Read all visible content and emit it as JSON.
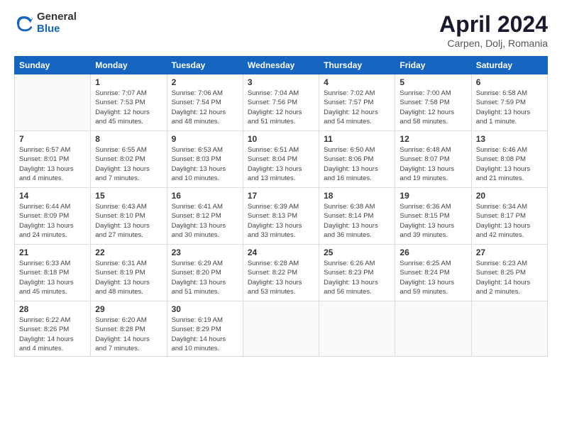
{
  "header": {
    "logo": {
      "general": "General",
      "blue": "Blue"
    },
    "title": "April 2024",
    "location": "Carpen, Dolj, Romania"
  },
  "calendar": {
    "days_of_week": [
      "Sunday",
      "Monday",
      "Tuesday",
      "Wednesday",
      "Thursday",
      "Friday",
      "Saturday"
    ],
    "weeks": [
      [
        {
          "day": "",
          "info": ""
        },
        {
          "day": "1",
          "info": "Sunrise: 7:07 AM\nSunset: 7:53 PM\nDaylight: 12 hours\nand 45 minutes."
        },
        {
          "day": "2",
          "info": "Sunrise: 7:06 AM\nSunset: 7:54 PM\nDaylight: 12 hours\nand 48 minutes."
        },
        {
          "day": "3",
          "info": "Sunrise: 7:04 AM\nSunset: 7:56 PM\nDaylight: 12 hours\nand 51 minutes."
        },
        {
          "day": "4",
          "info": "Sunrise: 7:02 AM\nSunset: 7:57 PM\nDaylight: 12 hours\nand 54 minutes."
        },
        {
          "day": "5",
          "info": "Sunrise: 7:00 AM\nSunset: 7:58 PM\nDaylight: 12 hours\nand 58 minutes."
        },
        {
          "day": "6",
          "info": "Sunrise: 6:58 AM\nSunset: 7:59 PM\nDaylight: 13 hours\nand 1 minute."
        }
      ],
      [
        {
          "day": "7",
          "info": "Sunrise: 6:57 AM\nSunset: 8:01 PM\nDaylight: 13 hours\nand 4 minutes."
        },
        {
          "day": "8",
          "info": "Sunrise: 6:55 AM\nSunset: 8:02 PM\nDaylight: 13 hours\nand 7 minutes."
        },
        {
          "day": "9",
          "info": "Sunrise: 6:53 AM\nSunset: 8:03 PM\nDaylight: 13 hours\nand 10 minutes."
        },
        {
          "day": "10",
          "info": "Sunrise: 6:51 AM\nSunset: 8:04 PM\nDaylight: 13 hours\nand 13 minutes."
        },
        {
          "day": "11",
          "info": "Sunrise: 6:50 AM\nSunset: 8:06 PM\nDaylight: 13 hours\nand 16 minutes."
        },
        {
          "day": "12",
          "info": "Sunrise: 6:48 AM\nSunset: 8:07 PM\nDaylight: 13 hours\nand 19 minutes."
        },
        {
          "day": "13",
          "info": "Sunrise: 6:46 AM\nSunset: 8:08 PM\nDaylight: 13 hours\nand 21 minutes."
        }
      ],
      [
        {
          "day": "14",
          "info": "Sunrise: 6:44 AM\nSunset: 8:09 PM\nDaylight: 13 hours\nand 24 minutes."
        },
        {
          "day": "15",
          "info": "Sunrise: 6:43 AM\nSunset: 8:10 PM\nDaylight: 13 hours\nand 27 minutes."
        },
        {
          "day": "16",
          "info": "Sunrise: 6:41 AM\nSunset: 8:12 PM\nDaylight: 13 hours\nand 30 minutes."
        },
        {
          "day": "17",
          "info": "Sunrise: 6:39 AM\nSunset: 8:13 PM\nDaylight: 13 hours\nand 33 minutes."
        },
        {
          "day": "18",
          "info": "Sunrise: 6:38 AM\nSunset: 8:14 PM\nDaylight: 13 hours\nand 36 minutes."
        },
        {
          "day": "19",
          "info": "Sunrise: 6:36 AM\nSunset: 8:15 PM\nDaylight: 13 hours\nand 39 minutes."
        },
        {
          "day": "20",
          "info": "Sunrise: 6:34 AM\nSunset: 8:17 PM\nDaylight: 13 hours\nand 42 minutes."
        }
      ],
      [
        {
          "day": "21",
          "info": "Sunrise: 6:33 AM\nSunset: 8:18 PM\nDaylight: 13 hours\nand 45 minutes."
        },
        {
          "day": "22",
          "info": "Sunrise: 6:31 AM\nSunset: 8:19 PM\nDaylight: 13 hours\nand 48 minutes."
        },
        {
          "day": "23",
          "info": "Sunrise: 6:29 AM\nSunset: 8:20 PM\nDaylight: 13 hours\nand 51 minutes."
        },
        {
          "day": "24",
          "info": "Sunrise: 6:28 AM\nSunset: 8:22 PM\nDaylight: 13 hours\nand 53 minutes."
        },
        {
          "day": "25",
          "info": "Sunrise: 6:26 AM\nSunset: 8:23 PM\nDaylight: 13 hours\nand 56 minutes."
        },
        {
          "day": "26",
          "info": "Sunrise: 6:25 AM\nSunset: 8:24 PM\nDaylight: 13 hours\nand 59 minutes."
        },
        {
          "day": "27",
          "info": "Sunrise: 6:23 AM\nSunset: 8:25 PM\nDaylight: 14 hours\nand 2 minutes."
        }
      ],
      [
        {
          "day": "28",
          "info": "Sunrise: 6:22 AM\nSunset: 8:26 PM\nDaylight: 14 hours\nand 4 minutes."
        },
        {
          "day": "29",
          "info": "Sunrise: 6:20 AM\nSunset: 8:28 PM\nDaylight: 14 hours\nand 7 minutes."
        },
        {
          "day": "30",
          "info": "Sunrise: 6:19 AM\nSunset: 8:29 PM\nDaylight: 14 hours\nand 10 minutes."
        },
        {
          "day": "",
          "info": ""
        },
        {
          "day": "",
          "info": ""
        },
        {
          "day": "",
          "info": ""
        },
        {
          "day": "",
          "info": ""
        }
      ]
    ]
  }
}
